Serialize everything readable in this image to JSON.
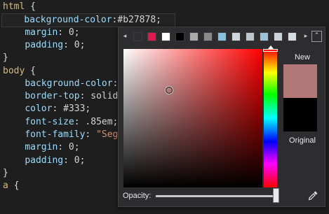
{
  "editor": {
    "lines": [
      {
        "sel": "html",
        "brace": " {"
      },
      {
        "prop": "background-color",
        "val": ":#b27878;"
      },
      {
        "prop": "margin",
        "val": ": 0;"
      },
      {
        "prop": "padding",
        "val": ": 0;"
      },
      {
        "brace": "}"
      },
      {
        "sel": "body",
        "brace": " {"
      },
      {
        "prop": "background-color",
        "val": ":"
      },
      {
        "prop": "border-top",
        "val": ": solid"
      },
      {
        "prop": "color",
        "val": ": #333;"
      },
      {
        "prop": "font-size",
        "val": ": .85em;"
      },
      {
        "prop": "font-family",
        "val": ": ",
        "str": "\"Seg"
      },
      {
        "prop": "margin",
        "val": ": 0;"
      },
      {
        "prop": "padding",
        "val": ": 0;"
      },
      {
        "brace": "}"
      },
      {
        "sel": "a",
        "brace": " {"
      }
    ]
  },
  "picker": {
    "swatches": [
      "#2d2d30",
      "#e0184d",
      "#ffffff",
      "#000000",
      "#aaaaaa",
      "#8a8a8a",
      "#87c0dc",
      "#cfd6dc",
      "#bcc6cd",
      "#9fc3d8",
      "#cad3da",
      "#d6dde2"
    ],
    "nav_prev": "◂",
    "nav_next": "▸",
    "collapse_icon": "⌃",
    "hue_level": 0.0,
    "saturation": 0.33,
    "brightness": 0.7,
    "new_label": "New",
    "original_label": "Original",
    "new_color": "#b27878",
    "original_color": "#000000",
    "opacity_label": "Opacity:",
    "opacity": 1.0,
    "eyedropper": "eyedropper-icon"
  }
}
